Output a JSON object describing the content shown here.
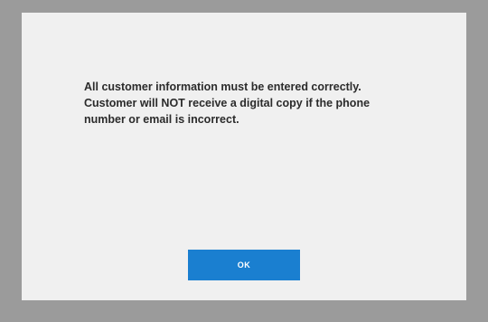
{
  "dialog": {
    "message_lines": [
      "All customer information must be entered correctly.",
      "Customer will NOT receive a digital copy if the phone",
      "number or email is incorrect."
    ],
    "ok_label": "OK"
  },
  "colors": {
    "backdrop": "#9b9b9b",
    "dialog_background": "#f0f0f0",
    "text": "#2b2b2b",
    "button_background": "#1a7fd0",
    "button_text": "#ffffff"
  }
}
